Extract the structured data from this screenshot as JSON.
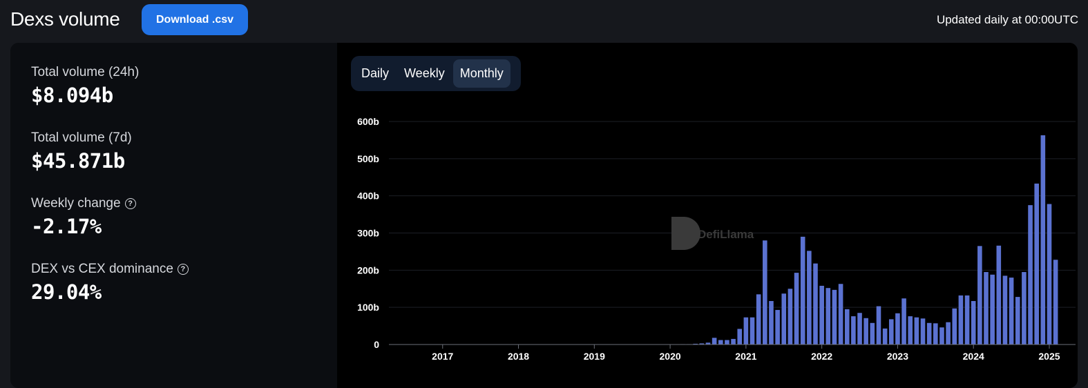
{
  "header": {
    "title": "Dexs volume",
    "download_label": "Download .csv",
    "updated_note": "Updated daily at 00:00UTC"
  },
  "stats": [
    {
      "label": "Total volume (24h)",
      "value": "$8.094b",
      "help": false
    },
    {
      "label": "Total volume (7d)",
      "value": "$45.871b",
      "help": false
    },
    {
      "label": "Weekly change",
      "value": "-2.17%",
      "help": true
    },
    {
      "label": "DEX vs CEX dominance",
      "value": "29.04%",
      "help": true
    }
  ],
  "toggle": {
    "options": [
      "Daily",
      "Weekly",
      "Monthly"
    ],
    "selected": "Monthly"
  },
  "watermark": "DefiLlama",
  "colors": {
    "bar": "#5b72d1",
    "accent": "#2172e5",
    "grid": "#1c1f26"
  },
  "chart_data": {
    "type": "bar",
    "title": "",
    "xlabel": "",
    "ylabel": "",
    "ylim": [
      0,
      600
    ],
    "y_unit": "b",
    "y_ticks": [
      "0",
      "100b",
      "200b",
      "300b",
      "400b",
      "500b",
      "600b"
    ],
    "x_ticks": [
      "2017",
      "2018",
      "2019",
      "2020",
      "2021",
      "2022",
      "2023",
      "2024",
      "2025"
    ],
    "x_start": "2016-05",
    "x_end": "2025-05",
    "series": [
      {
        "name": "",
        "x": [
          "2020-01",
          "2020-02",
          "2020-03",
          "2020-04",
          "2020-05",
          "2020-06",
          "2020-07",
          "2020-08",
          "2020-09",
          "2020-10",
          "2020-11",
          "2020-12",
          "2021-01",
          "2021-02",
          "2021-03",
          "2021-04",
          "2021-05",
          "2021-06",
          "2021-07",
          "2021-08",
          "2021-09",
          "2021-10",
          "2021-11",
          "2021-12",
          "2022-01",
          "2022-02",
          "2022-03",
          "2022-04",
          "2022-05",
          "2022-06",
          "2022-07",
          "2022-08",
          "2022-09",
          "2022-10",
          "2022-11",
          "2022-12",
          "2023-01",
          "2023-02",
          "2023-03",
          "2023-04",
          "2023-05",
          "2023-06",
          "2023-07",
          "2023-08",
          "2023-09",
          "2023-10",
          "2023-11",
          "2023-12",
          "2024-01",
          "2024-02",
          "2024-03",
          "2024-04",
          "2024-05",
          "2024-06",
          "2024-07",
          "2024-08",
          "2024-09",
          "2024-10",
          "2024-11",
          "2024-12",
          "2025-01",
          "2025-02",
          "2025-03"
        ],
        "values": [
          0.5,
          0.5,
          1,
          1,
          2,
          3,
          5,
          18,
          12,
          12,
          15,
          42,
          73,
          73,
          135,
          280,
          117,
          93,
          137,
          150,
          193,
          290,
          252,
          218,
          158,
          152,
          147,
          163,
          95,
          76,
          85,
          71,
          58,
          103,
          43,
          68,
          84,
          124,
          76,
          73,
          70,
          58,
          57,
          46,
          60,
          97,
          132,
          132,
          117,
          265,
          195,
          188,
          266,
          185,
          180,
          128,
          195,
          375,
          433,
          563,
          378,
          228,
          0
        ]
      }
    ]
  }
}
